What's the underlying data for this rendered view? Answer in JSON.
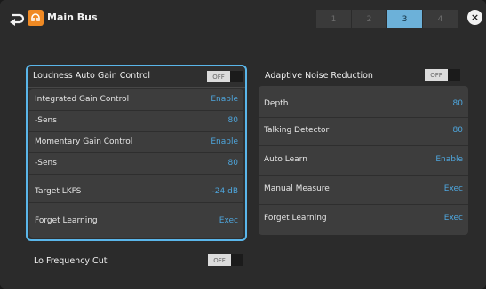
{
  "header": {
    "title": "Main Bus",
    "pages": [
      "1",
      "2",
      "3",
      "4"
    ],
    "active_page": "3",
    "close_symbol": "×"
  },
  "icons": {
    "back": "back-arrow-icon",
    "bus": "bus-icon",
    "close": "close-icon"
  },
  "colors": {
    "accent_blue": "#4ea6dd",
    "group_border": "#5ab6ea",
    "page_active": "#6cb1d9",
    "bus_orange": "#f08a24"
  },
  "loudness": {
    "label": "Loudness Auto Gain Control",
    "toggle": "OFF",
    "rows": [
      {
        "label": "Integrated Gain Control",
        "value": "Enable"
      },
      {
        "label": "-Sens",
        "value": "80"
      },
      {
        "label": "Momentary Gain Control",
        "value": "Enable"
      },
      {
        "label": "-Sens",
        "value": "80"
      },
      {
        "label": "Target LKFS",
        "value": "-24 dB"
      },
      {
        "label": "Forget Learning",
        "value": "Exec"
      }
    ]
  },
  "noise": {
    "label": "Adaptive Noise Reduction",
    "toggle": "OFF",
    "rows": [
      {
        "label": "Depth",
        "value": "80"
      },
      {
        "label": "Talking Detector",
        "value": "80"
      },
      {
        "label": "Auto Learn",
        "value": "Enable"
      },
      {
        "label": "Manual Measure",
        "value": "Exec"
      },
      {
        "label": "Forget Learning",
        "value": "Exec"
      }
    ]
  },
  "lo_freq": {
    "label": "Lo Frequency Cut",
    "toggle": "OFF"
  }
}
